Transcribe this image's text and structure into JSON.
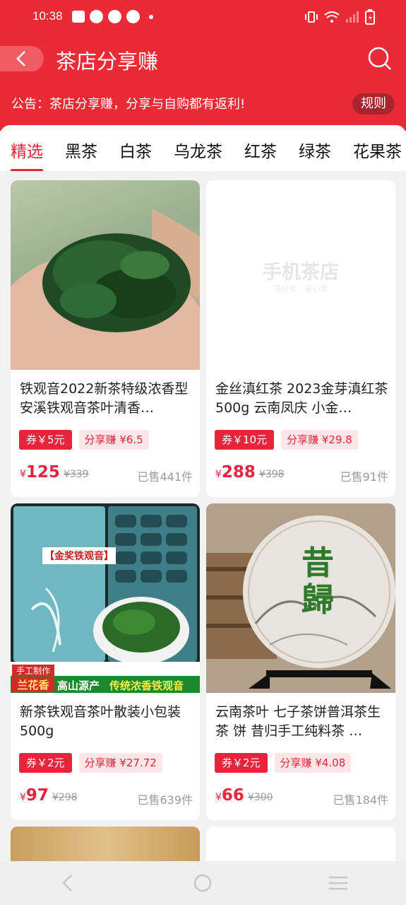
{
  "status_bar": {
    "time": "10:38"
  },
  "header": {
    "title": "茶店分享赚"
  },
  "notice": {
    "text": "公告：茶店分享赚，分享与自购都有返利!",
    "rule_label": "规则"
  },
  "tabs": [
    "精选",
    "黑茶",
    "白茶",
    "乌龙茶",
    "红茶",
    "绿茶",
    "花果茶"
  ],
  "products": [
    {
      "name": "铁观音2022新茶特级浓香型安溪铁观音茶叶清香…",
      "coupon": "券￥5元",
      "share": "分享赚 ¥6.5",
      "currency": "¥",
      "price": "125",
      "original_price": "¥339",
      "sold": "已售441件",
      "image": "loose-leaf-oolong-in-hand"
    },
    {
      "name": "金丝滇红茶 2023金芽滇红茶500g 云南凤庆 小金…",
      "coupon": "券￥10元",
      "share": "分享赚 ¥29.8",
      "currency": "¥",
      "price": "288",
      "original_price": "¥398",
      "sold": "已售91件",
      "image": "placeholder",
      "placeholder_title": "手机茶店",
      "placeholder_sub": "茶好卖 · 省心做"
    },
    {
      "name": "新茶铁观音茶叶散装小包装500g",
      "coupon": "券￥2元",
      "share": "分享赚 ¥27.72",
      "currency": "¥",
      "price": "97",
      "original_price": "¥298",
      "sold": "已售639件",
      "image": "tieguanyin-gift-box",
      "img_labels": {
        "box": "【金奖铁观音】",
        "tag1": "手工制作",
        "tag2": "兰花香",
        "band1": "高山源产",
        "band2": "传统浓香铁观音"
      }
    },
    {
      "name": "云南茶叶 七子茶饼普洱茶生茶 饼 昔归手工纯料茶 …",
      "coupon": "券￥2元",
      "share": "分享赚 ¥4.08",
      "currency": "¥",
      "price": "66",
      "original_price": "¥300",
      "sold": "已售184件",
      "image": "puer-tea-cake",
      "img_labels": {
        "cake": "昔歸"
      }
    }
  ],
  "colors": {
    "primary": "#ea2a34",
    "accent": "#e8233c",
    "share_bg": "#fde6e7"
  }
}
